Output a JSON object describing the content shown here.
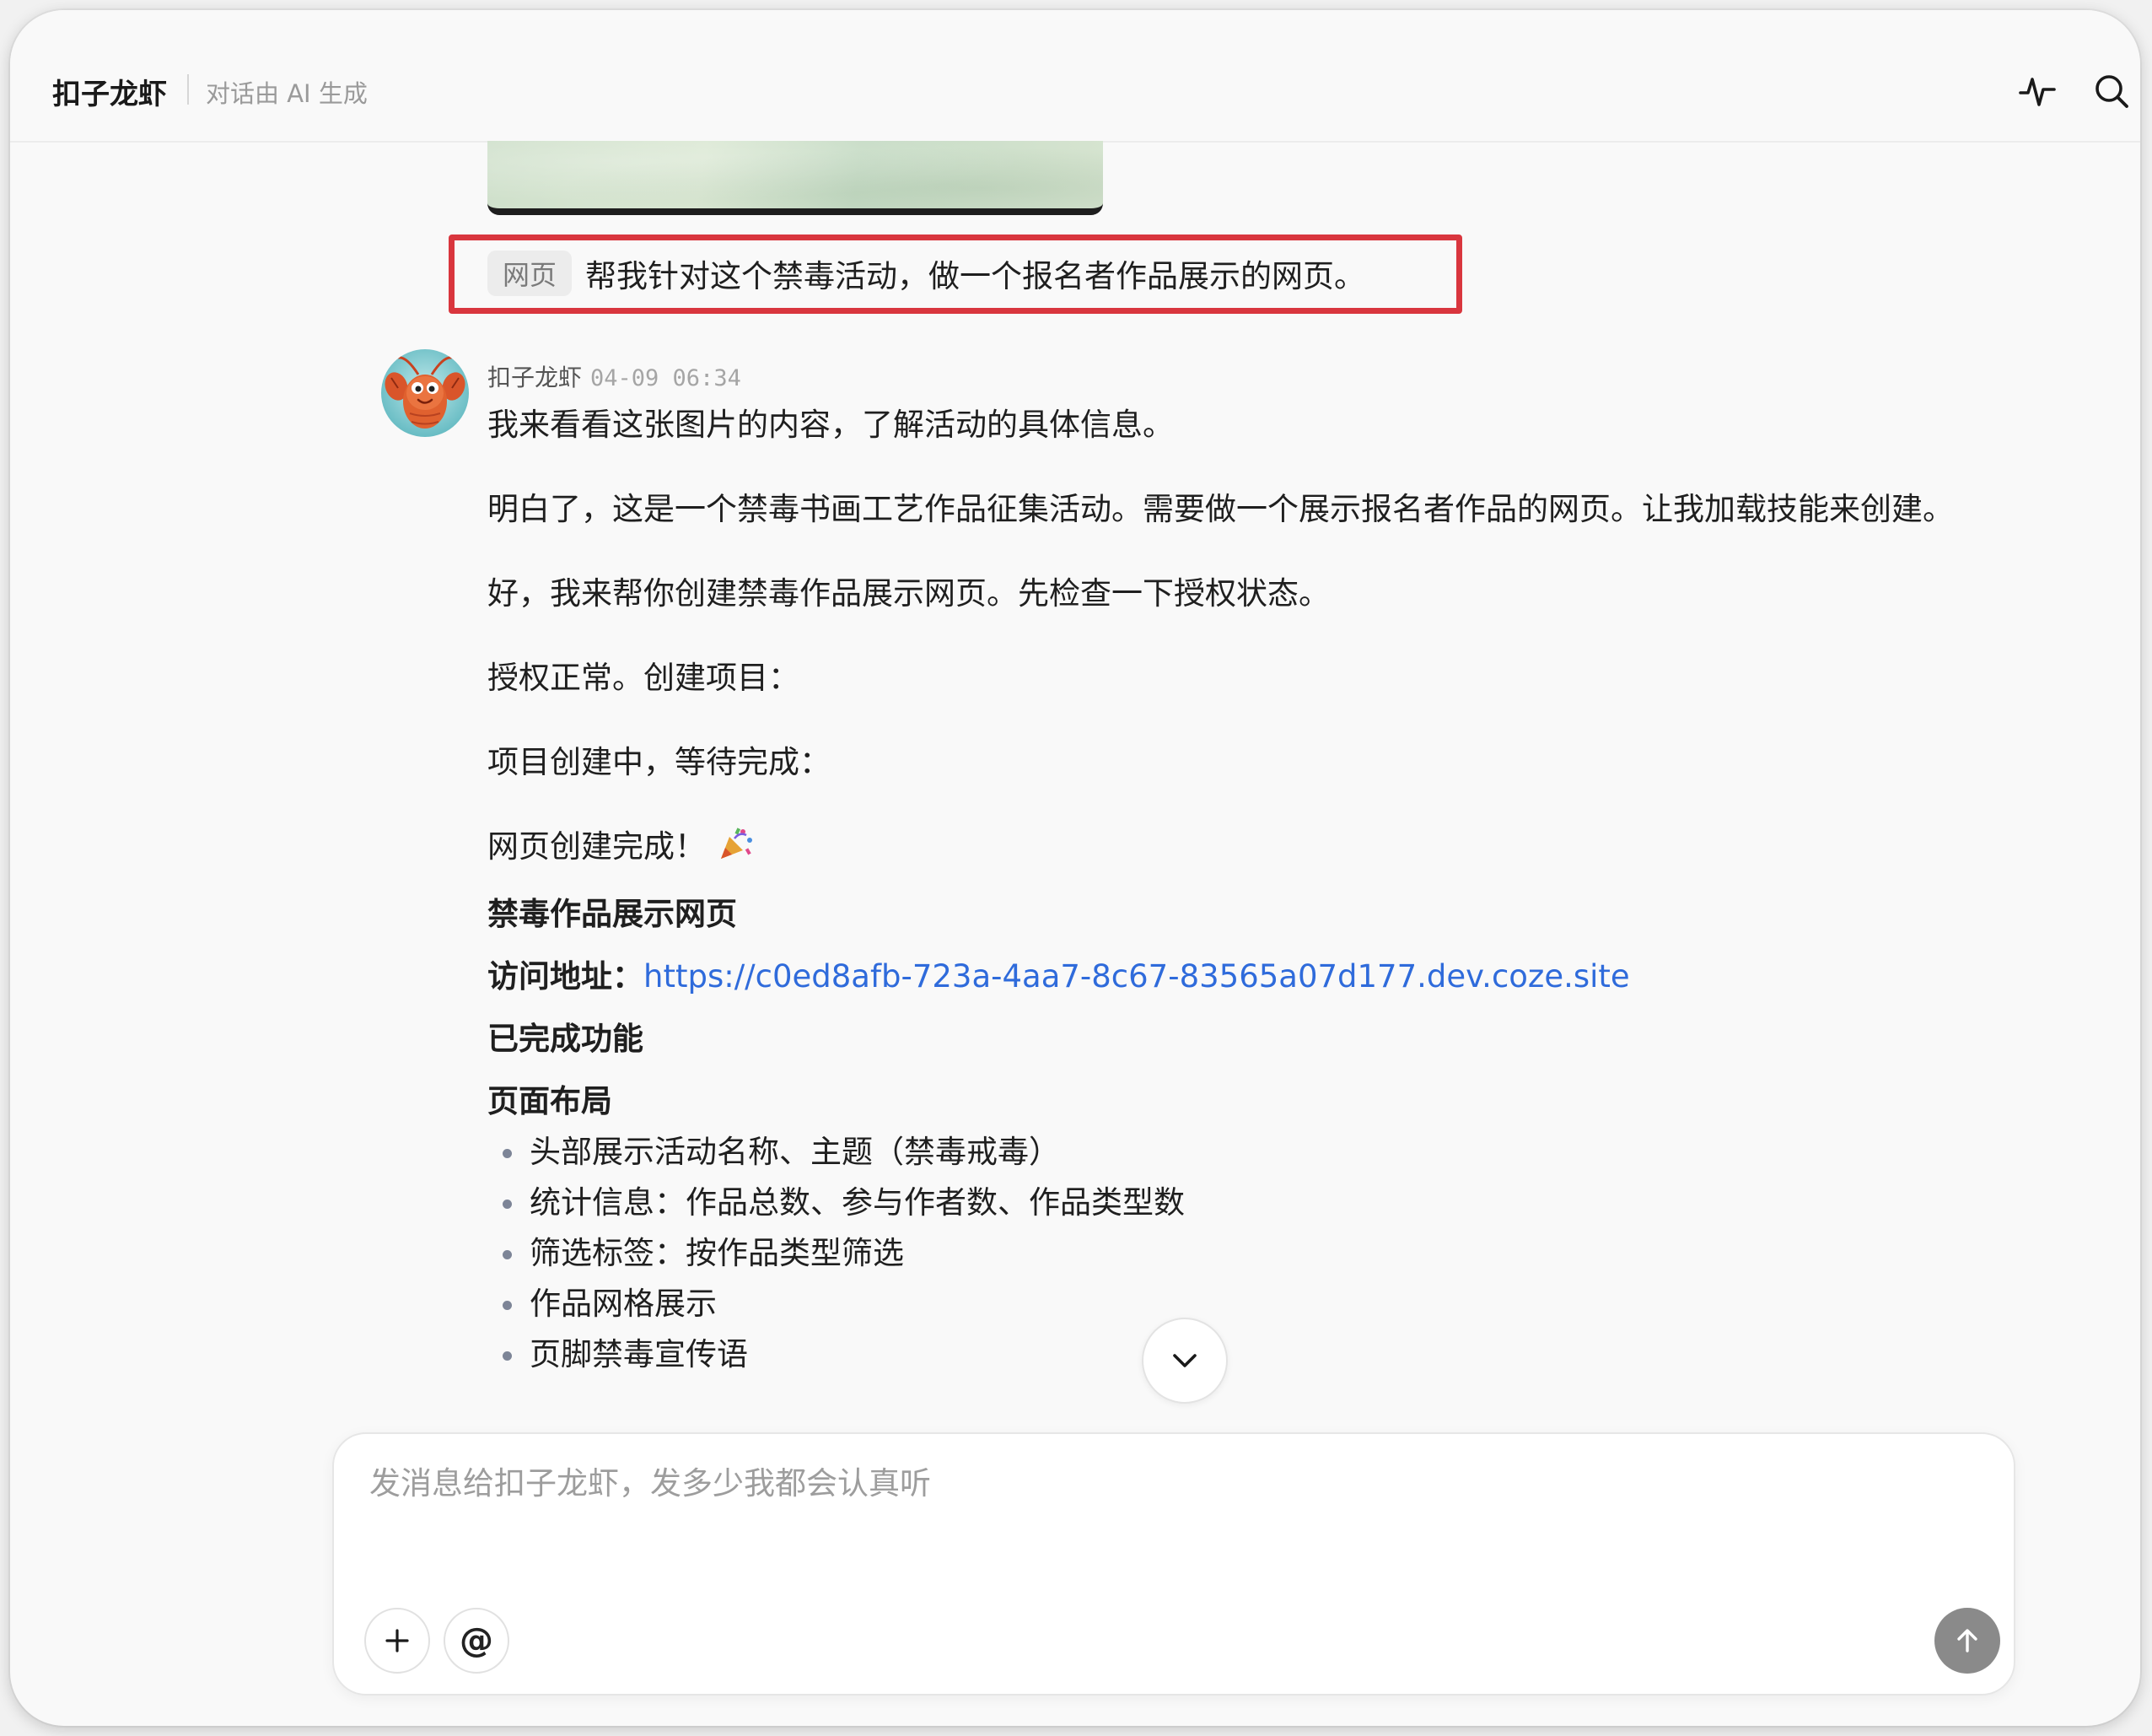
{
  "header": {
    "title": "扣子龙虾",
    "subtitle": "对话由 AI 生成",
    "activity_icon": "activity-pulse-icon",
    "search_icon": "search-icon"
  },
  "user_message": {
    "tag": "网页",
    "text": "帮我针对这个禁毒活动，做一个报名者作品展示的网页。"
  },
  "bot_message": {
    "name": "扣子龙虾",
    "time": "04-09 06:34",
    "para1": "我来看看这张图片的内容，了解活动的具体信息。",
    "para2": "明白了，这是一个禁毒书画工艺作品征集活动。需要做一个展示报名者作品的网页。让我加载技能来创建。",
    "para3": "好，我来帮你创建禁毒作品展示网页。先检查一下授权状态。",
    "para4": "授权正常。创建项目：",
    "para5": "项目创建中，等待完成：",
    "done_text": "网页创建完成！",
    "done_emoji": "party-popper-icon",
    "heading": "禁毒作品展示网页",
    "url_label": "访问地址：",
    "url": "https://c0ed8afb-723a-4aa7-8c67-83565a07d177.dev.coze.site",
    "features_heading": "已完成功能",
    "layout_heading": "页面布局",
    "layout_items": [
      "头部展示活动名称、主题（禁毒戒毒）",
      "统计信息：作品总数、参与作者数、作品类型数",
      "筛选标签：按作品类型筛选",
      "作品网格展示",
      "页脚禁毒宣传语"
    ]
  },
  "composer": {
    "placeholder": "发消息给扣子龙虾，发多少我都会认真听",
    "add_label": "+",
    "mention_label": "@"
  },
  "colors": {
    "highlight_border": "#d9363e",
    "link": "#2f6bdb",
    "send_button": "#8a8a8a"
  }
}
